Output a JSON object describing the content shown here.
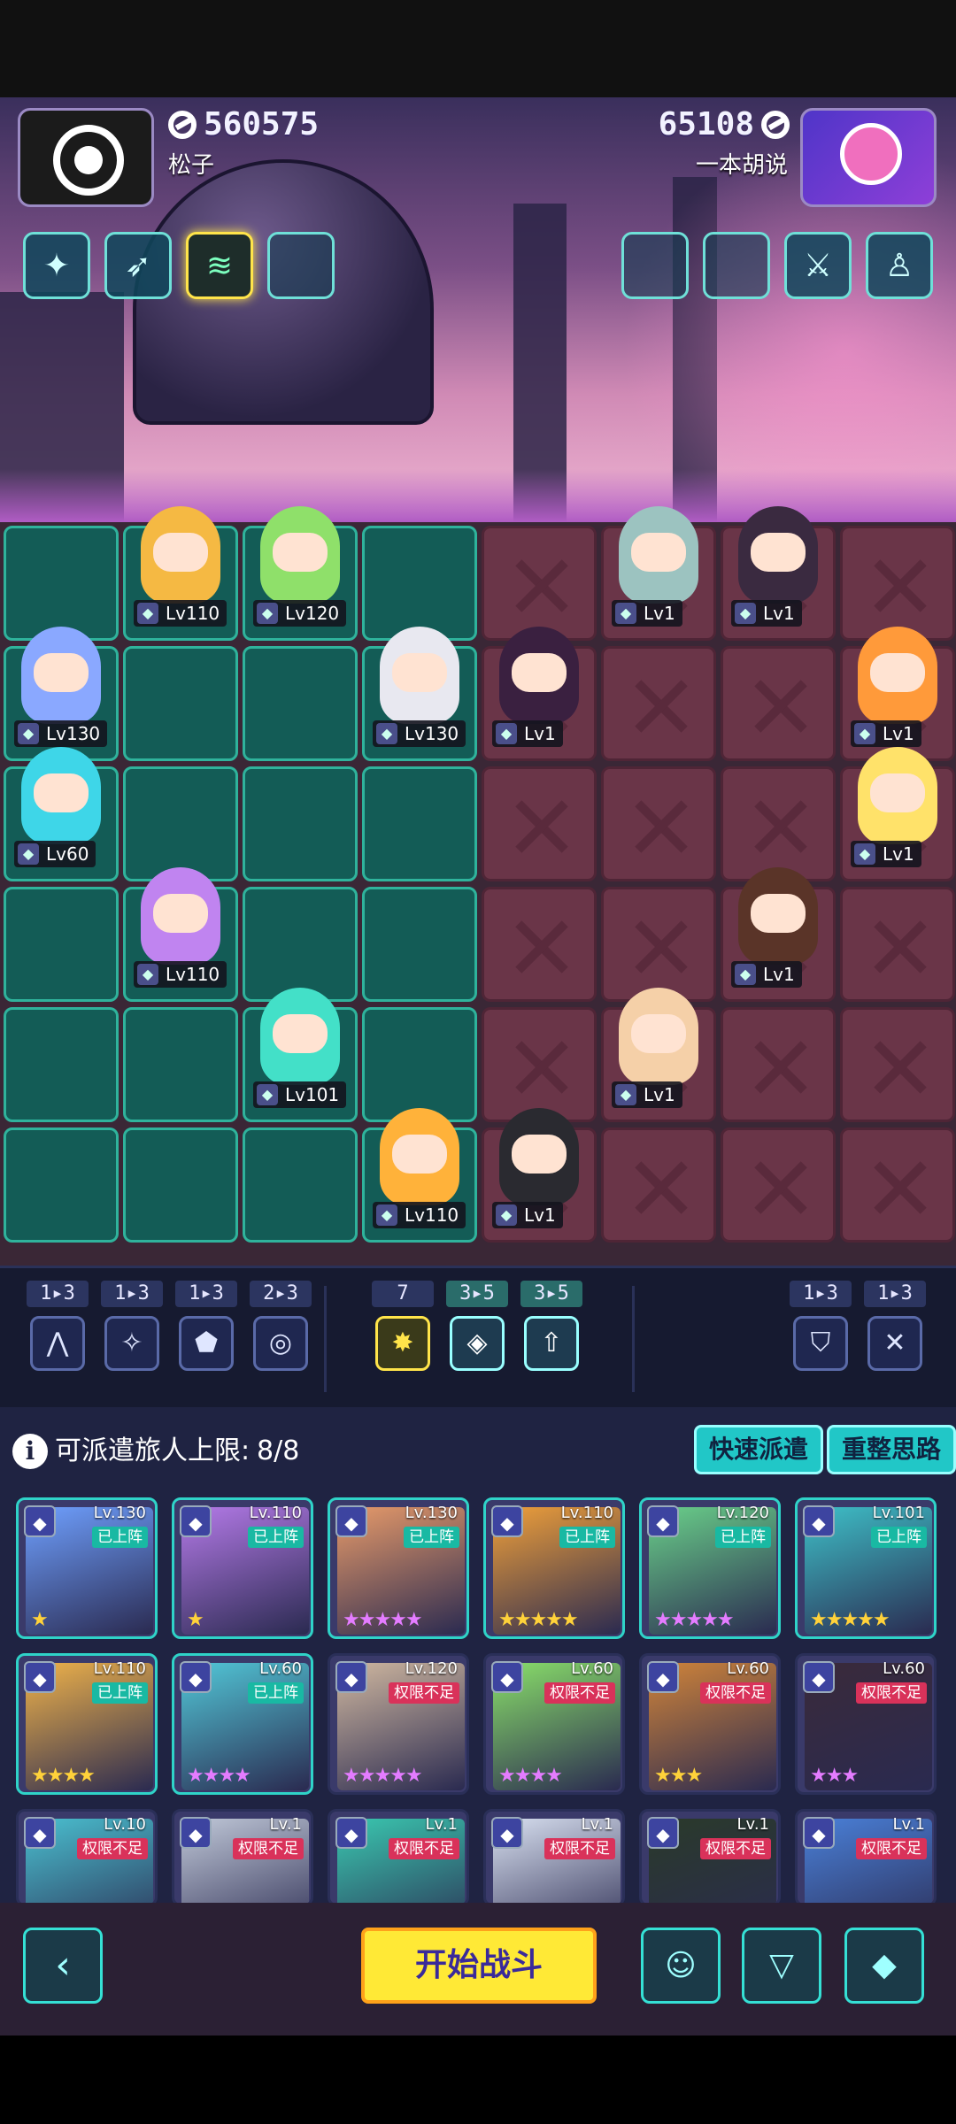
{
  "players": {
    "left": {
      "score": "560575",
      "name": "松子"
    },
    "right": {
      "score": "65108",
      "name": "一本胡说"
    }
  },
  "left_synergies": [
    {
      "icon": "sparkle-wand-icon"
    },
    {
      "icon": "arrows-icon"
    },
    {
      "icon": "cables-icon",
      "active": true
    },
    {
      "icon": "empty-slot"
    }
  ],
  "right_synergies": [
    {
      "icon": "empty-slot"
    },
    {
      "icon": "empty-slot"
    },
    {
      "icon": "sword-icon"
    },
    {
      "icon": "meditating-figure-icon"
    }
  ],
  "own_units": [
    {
      "level": "Lv110",
      "color": "#f5b943"
    },
    {
      "level": "Lv120",
      "color": "#8fe06a"
    },
    {
      "level": "Lv130",
      "color": "#8aa8ff"
    },
    {
      "level": "Lv130",
      "color": "#e8e8f0"
    },
    {
      "level": "Lv60",
      "color": "#3ed6e8"
    },
    {
      "level": "Lv110",
      "color": "#c084f0"
    },
    {
      "level": "Lv101",
      "color": "#43e0c8"
    },
    {
      "level": "Lv110",
      "color": "#ffb23a"
    }
  ],
  "enemy_units": [
    {
      "level": "Lv1",
      "color": "#9cc3c0"
    },
    {
      "level": "Lv1",
      "color": "#3a2a40"
    },
    {
      "level": "Lv1",
      "color": "#3a2040"
    },
    {
      "level": "Lv1",
      "color": "#ff9a3a"
    },
    {
      "level": "Lv1",
      "color": "#ffe26a"
    },
    {
      "level": "Lv1",
      "color": "#5a3428"
    },
    {
      "level": "Lv1",
      "color": "#f5d0a8"
    },
    {
      "level": "Lv1",
      "color": "#2a2a30"
    }
  ],
  "traits": [
    {
      "count": "1▸3",
      "icon": "mountain-icon"
    },
    {
      "count": "1▸3",
      "icon": "shuriken-icon"
    },
    {
      "count": "1▸3",
      "icon": "pentagon-rune-icon"
    },
    {
      "count": "2▸3",
      "icon": "swirl-icon"
    },
    {
      "count": "7",
      "icon": "starburst-icon",
      "gold": true
    },
    {
      "count": "3▸5",
      "icon": "diamond-rune-icon",
      "active": true
    },
    {
      "count": "3▸5",
      "icon": "up-arrow-icon",
      "active": true
    },
    {
      "count": "1▸3",
      "icon": "shield-icon"
    },
    {
      "count": "1▸3",
      "icon": "crossed-swords-icon"
    }
  ],
  "roster": {
    "limit_label": "可派遣旅人上限:",
    "limit_value": "8/8",
    "quick_deploy": "快速派遣",
    "reset": "重整思路",
    "tag_on": "已上阵",
    "tag_noauth": "权限不足",
    "cards": [
      {
        "lv": "Lv.130",
        "tag": "on",
        "color": "#6fa0ff",
        "stars": "★",
        "star_color": "gold"
      },
      {
        "lv": "Lv.110",
        "tag": "on",
        "color": "#b47ae8",
        "stars": "★",
        "star_color": "gold"
      },
      {
        "lv": "Lv.130",
        "tag": "on",
        "color": "#e89b6a",
        "stars": "★★★★★",
        "star_color": "pink"
      },
      {
        "lv": "Lv.110",
        "tag": "on",
        "color": "#f0a03a",
        "stars": "★★★★★",
        "star_color": "gold"
      },
      {
        "lv": "Lv.120",
        "tag": "on",
        "color": "#6ad08a",
        "stars": "★★★★★",
        "star_color": "pink"
      },
      {
        "lv": "Lv.101",
        "tag": "on",
        "color": "#3ec0c8",
        "stars": "★★★★★",
        "star_color": "gold"
      },
      {
        "lv": "Lv.110",
        "tag": "on",
        "color": "#f0b34a",
        "stars": "★★★★",
        "star_color": "gold"
      },
      {
        "lv": "Lv.60",
        "tag": "on",
        "color": "#52c8d8",
        "stars": "★★★★",
        "star_color": "pink"
      },
      {
        "lv": "Lv.120",
        "tag": "noauth",
        "color": "#d0b8a0",
        "stars": "★★★★★",
        "star_color": "pink"
      },
      {
        "lv": "Lv.60",
        "tag": "noauth",
        "color": "#8ae06a",
        "stars": "★★★★",
        "star_color": "pink"
      },
      {
        "lv": "Lv.60",
        "tag": "noauth",
        "color": "#d0843a",
        "stars": "★★★",
        "star_color": "gold"
      },
      {
        "lv": "Lv.60",
        "tag": "noauth",
        "color": "#3a2a3a",
        "stars": "★★★",
        "star_color": "pink"
      },
      {
        "lv": "Lv.10",
        "tag": "noauth",
        "color": "#4ac0d0",
        "stars": "",
        "star_color": "gold"
      },
      {
        "lv": "Lv.1",
        "tag": "noauth",
        "color": "#c0c8d8",
        "stars": "",
        "star_color": "gold"
      },
      {
        "lv": "Lv.1",
        "tag": "noauth",
        "color": "#3ac8b0",
        "stars": "",
        "star_color": "gold"
      },
      {
        "lv": "Lv.1",
        "tag": "noauth",
        "color": "#d8e0f0",
        "stars": "",
        "star_color": "gold"
      },
      {
        "lv": "Lv.1",
        "tag": "noauth",
        "color": "#2a3a2a",
        "stars": "",
        "star_color": "gold"
      },
      {
        "lv": "Lv.1",
        "tag": "noauth",
        "color": "#4a80d8",
        "stars": "",
        "star_color": "gold"
      }
    ]
  },
  "bottom": {
    "start_label": "开始战斗",
    "buttons": [
      "back-arrow-icon",
      "brain-head-icon",
      "filter-icon",
      "sort-icon"
    ]
  }
}
